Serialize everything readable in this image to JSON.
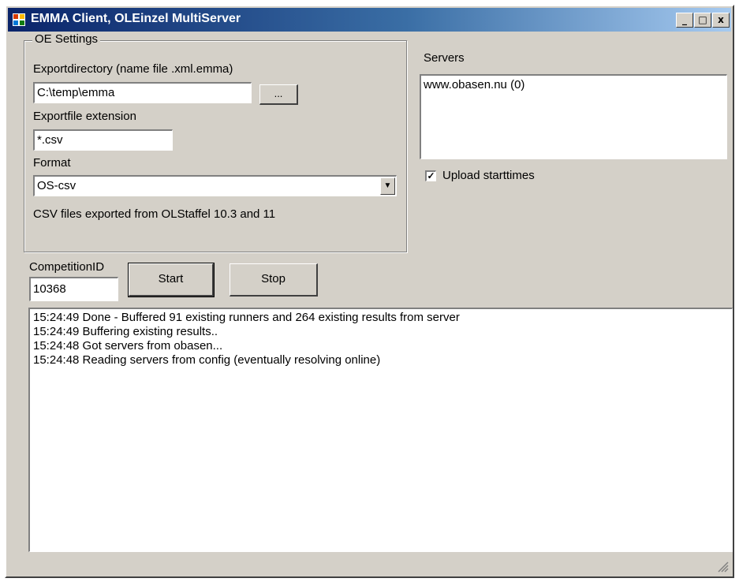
{
  "window": {
    "title": "EMMA Client, OLEinzel MultiServer"
  },
  "title_buttons": {
    "minimize": "_",
    "maximize": "□",
    "close": "x"
  },
  "oe_settings": {
    "legend": "OE Settings",
    "export_dir_label": "Exportdirectory (name file .xml.emma)",
    "export_dir_value": "C:\\temp\\emma",
    "browse_label": "...",
    "ext_label": "Exportfile extension",
    "ext_value": "*.csv",
    "format_label": "Format",
    "format_value": "OS-csv",
    "format_desc": "CSV files exported from OLStaffel 10.3 and 11"
  },
  "servers": {
    "label": "Servers",
    "items": [
      "www.obasen.nu (0)"
    ],
    "upload_label": "Upload starttimes",
    "upload_checked": true
  },
  "competition": {
    "label": "CompetitionID",
    "value": "10368",
    "start_label": "Start",
    "stop_label": "Stop"
  },
  "log": [
    "15:24:49 Done - Buffered 91 existing runners and 264 existing results from server",
    "15:24:49 Buffering existing results..",
    "15:24:48 Got servers from obasen...",
    "15:24:48 Reading servers from config (eventually resolving online)"
  ]
}
